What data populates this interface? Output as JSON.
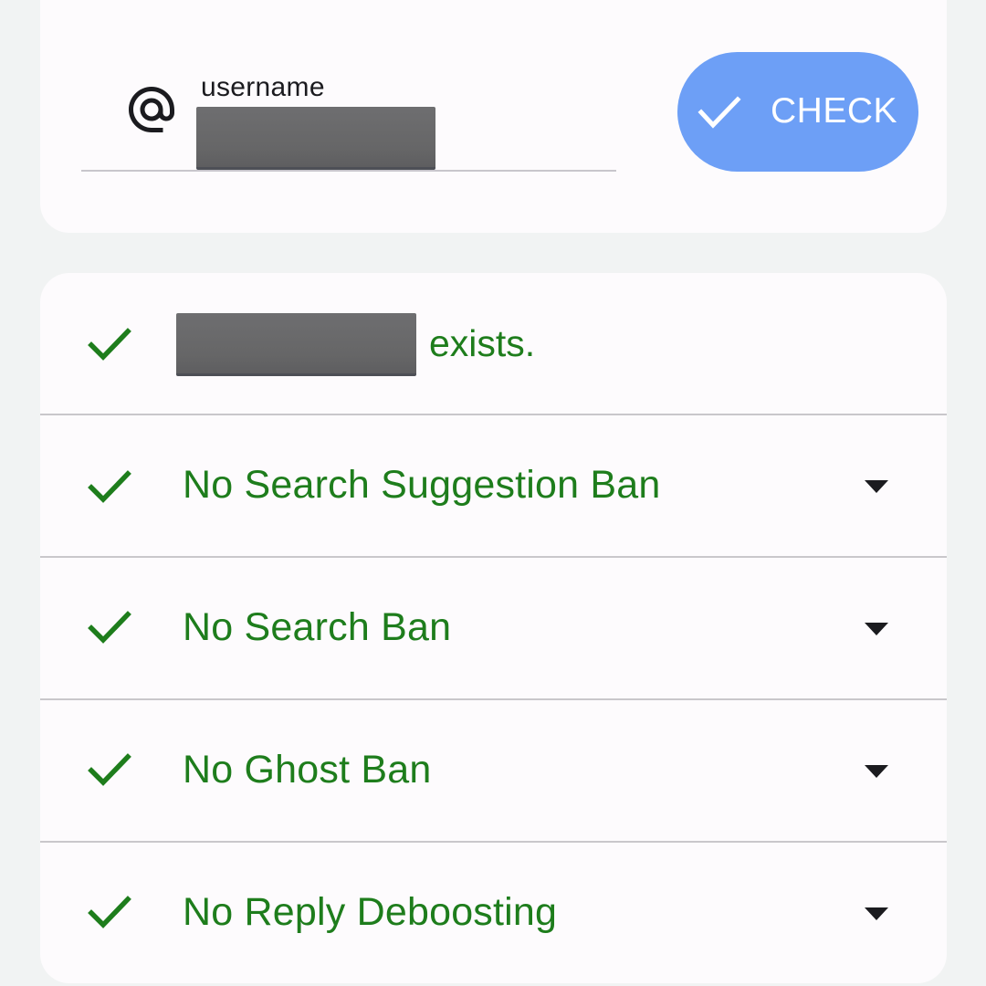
{
  "search": {
    "field_icon": "at-icon",
    "field_label": "username",
    "button": {
      "icon": "check-icon",
      "label": "CHECK"
    }
  },
  "results": {
    "exists_suffix": "exists.",
    "status_icon": "check-icon",
    "expand_icon": "dropdown-arrow-icon",
    "items": [
      {
        "label": "No Search Suggestion Ban"
      },
      {
        "label": "No Search Ban"
      },
      {
        "label": "No Ghost Ban"
      },
      {
        "label": "No Reply Deboosting"
      }
    ]
  },
  "colors": {
    "background": "#f1f3f3",
    "card": "#fdfbfd",
    "accent_button": "#6d9ff6",
    "status_green": "#1e7d1c",
    "divider": "#c9c7cb"
  }
}
